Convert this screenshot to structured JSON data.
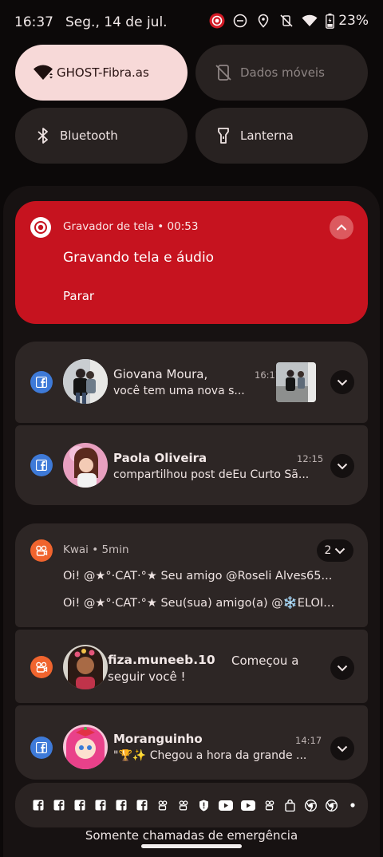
{
  "status_bar": {
    "time": "16:37",
    "date": "Seg., 14 de jul.",
    "battery": "23%",
    "icons": [
      "screen-record-icon",
      "dnd-icon",
      "location-icon",
      "vibrate-off-icon",
      "wifi-icon",
      "battery-icon"
    ]
  },
  "quick_tiles": [
    {
      "label": "GHOST-Fibra.as",
      "icon": "wifi-icon",
      "state": "active"
    },
    {
      "label": "Dados móveis",
      "icon": "mobile-data-off-icon",
      "state": "inactive"
    },
    {
      "label": "Bluetooth",
      "icon": "bluetooth-icon",
      "state": "off"
    },
    {
      "label": "Lanterna",
      "icon": "flashlight-icon",
      "state": "off"
    }
  ],
  "recorder": {
    "app": "Gravador de tela • 00:53",
    "title": "Gravando tela e áudio",
    "action": "Parar",
    "accent": "#c6131f"
  },
  "notifications": {
    "giovana": {
      "name": "Giovana Moura,",
      "text": "você tem uma nova s...",
      "time": "16:17",
      "app": "facebook"
    },
    "paola": {
      "name": "Paola Oliveira",
      "text": "compartilhou post deEu Curto Sã...",
      "time": "12:15",
      "app": "facebook"
    },
    "kwai": {
      "app": "Kwai • 5min",
      "count": "2",
      "lines": [
        "Oi! @★°·CAT·°★ Seu amigo @Roseli Alves65...",
        "Oi! @★°·CAT·°★ Seu(sua) amigo(a) @❄️ELOI..."
      ]
    },
    "fiza": {
      "name": "fiza.muneeb.10",
      "text_inline": "Começou a",
      "text_line2": "seguir você !",
      "app": "kwai"
    },
    "moranguinho": {
      "name": "Moranguinho",
      "text": "\"🏆✨ Chegou a hora da grande ...",
      "time": "14:17",
      "app": "facebook"
    }
  },
  "tray_icons": [
    "facebook-icon",
    "facebook-icon",
    "facebook-icon",
    "facebook-icon",
    "facebook-icon",
    "facebook-icon",
    "kwai-icon",
    "kwai-icon",
    "shield-icon",
    "youtube-icon",
    "youtube-icon",
    "kwai-icon",
    "bag-icon",
    "chrome-icon",
    "chrome-icon",
    "dot-icon"
  ],
  "footer": {
    "emergency": "Somente chamadas de emergência"
  }
}
